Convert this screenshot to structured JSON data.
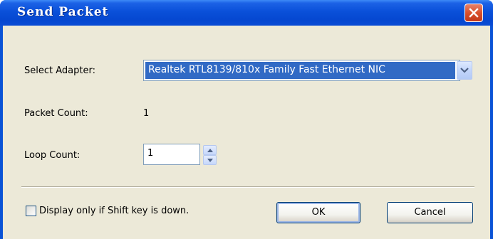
{
  "window": {
    "title": "Send Packet"
  },
  "adapter": {
    "label": "Select Adapter:",
    "selected": "Realtek RTL8139/810x Family Fast Ethernet NIC"
  },
  "packet_count": {
    "label": "Packet Count:",
    "value": "1"
  },
  "loop_count": {
    "label": "Loop Count:",
    "value": "1"
  },
  "shift_option": {
    "label": "Display only if Shift key is down.",
    "checked": false
  },
  "buttons": {
    "ok": "OK",
    "cancel": "Cancel"
  },
  "colors": {
    "titlebar": "#0a50d9",
    "selection": "#316ac5",
    "dialog_bg": "#ece9d8",
    "close": "#d9502c"
  },
  "icons": {
    "close": "close-icon",
    "dropdown": "chevron-down-icon",
    "spin_up": "triangle-up-icon",
    "spin_down": "triangle-down-icon"
  }
}
